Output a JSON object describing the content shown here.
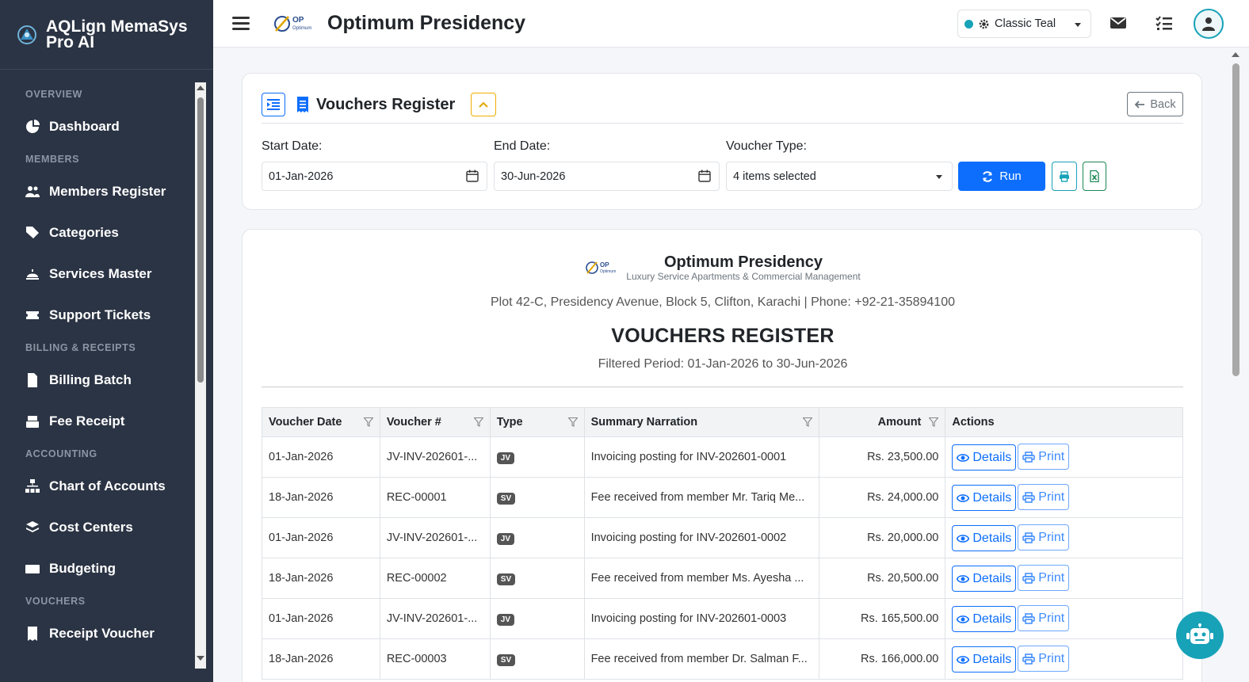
{
  "app": {
    "title": "AQLign MemaSys Pro AI"
  },
  "sidebar": {
    "sections": [
      {
        "label": "OVERVIEW",
        "items": [
          {
            "label": "Dashboard",
            "icon": "pie-chart-icon"
          }
        ]
      },
      {
        "label": "MEMBERS",
        "items": [
          {
            "label": "Members Register",
            "icon": "users-icon"
          },
          {
            "label": "Categories",
            "icon": "tags-icon"
          },
          {
            "label": "Services Master",
            "icon": "bell-concierge-icon"
          },
          {
            "label": "Support Tickets",
            "icon": "ticket-icon"
          }
        ]
      },
      {
        "label": "BILLING & RECEIPTS",
        "items": [
          {
            "label": "Billing Batch",
            "icon": "file-invoice-icon"
          },
          {
            "label": "Fee Receipt",
            "icon": "cash-register-icon"
          }
        ]
      },
      {
        "label": "ACCOUNTING",
        "items": [
          {
            "label": "Chart of Accounts",
            "icon": "sitemap-icon"
          },
          {
            "label": "Cost Centers",
            "icon": "layers-icon"
          },
          {
            "label": "Budgeting",
            "icon": "money-icon"
          }
        ]
      },
      {
        "label": "VOUCHERS",
        "items": [
          {
            "label": "Receipt Voucher",
            "icon": "receipt-icon"
          }
        ]
      }
    ]
  },
  "header": {
    "title": "Optimum Presidency",
    "theme": {
      "label": "Classic Teal",
      "color": "#17a2b8"
    }
  },
  "filter_card": {
    "title": "Vouchers Register",
    "back_label": "Back",
    "start_date": {
      "label": "Start Date:",
      "value": "01-Jan-2026"
    },
    "end_date": {
      "label": "End Date:",
      "value": "30-Jun-2026"
    },
    "voucher_type": {
      "label": "Voucher Type:",
      "value": "4 items selected"
    },
    "run_label": "Run"
  },
  "report": {
    "company": "Optimum Presidency",
    "tagline": "Luxury Service Apartments & Commercial Management",
    "address": "Plot 42-C, Presidency Avenue, Block 5, Clifton, Karachi | Phone: +92-21-35894100",
    "title": "VOUCHERS REGISTER",
    "period": "Filtered Period: 01-Jan-2026 to 30-Jun-2026",
    "columns": [
      "Voucher Date",
      "Voucher #",
      "Type",
      "Summary Narration",
      "Amount",
      "Actions"
    ],
    "details_label": "Details",
    "print_label": "Print",
    "rows": [
      {
        "date": "01-Jan-2026",
        "voucher": "JV-INV-202601-...",
        "type": "JV",
        "narration": "Invoicing posting for INV-202601-0001",
        "amount": "Rs. 23,500.00"
      },
      {
        "date": "18-Jan-2026",
        "voucher": "REC-00001",
        "type": "SV",
        "narration": "Fee received from member Mr. Tariq Me...",
        "amount": "Rs. 24,000.00"
      },
      {
        "date": "01-Jan-2026",
        "voucher": "JV-INV-202601-...",
        "type": "JV",
        "narration": "Invoicing posting for INV-202601-0002",
        "amount": "Rs. 20,000.00"
      },
      {
        "date": "18-Jan-2026",
        "voucher": "REC-00002",
        "type": "SV",
        "narration": "Fee received from member Ms. Ayesha ...",
        "amount": "Rs. 20,500.00"
      },
      {
        "date": "01-Jan-2026",
        "voucher": "JV-INV-202601-...",
        "type": "JV",
        "narration": "Invoicing posting for INV-202601-0003",
        "amount": "Rs. 165,500.00"
      },
      {
        "date": "18-Jan-2026",
        "voucher": "REC-00003",
        "type": "SV",
        "narration": "Fee received from member Dr. Salman F...",
        "amount": "Rs. 166,000.00"
      }
    ]
  }
}
